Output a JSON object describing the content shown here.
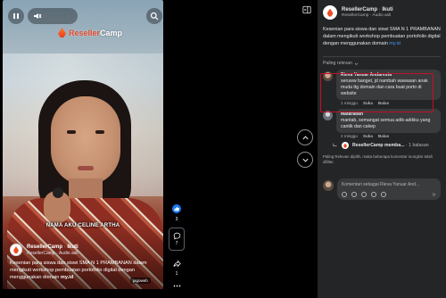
{
  "video": {
    "logo_brand": "Reseller",
    "logo_suffix": "Camp",
    "caption": "NAMA AKU CELINE ARTHA",
    "page_name": "ResellerCamp",
    "follow": "Ikuti",
    "audio": "ResellerCamp · Audio asli",
    "description": "Kesenian para siswa dan siswi SMA N 1 PRAMBANAN dalam mengikuti workshop pembuatan portofolio digital dengan menggunakan domain",
    "domain_link": "my.id",
    "watermark": "jagoweb"
  },
  "rail": {
    "like_count": "3",
    "comment_count": "7",
    "share_count": "1"
  },
  "panel": {
    "page_name": "ResellerCamp",
    "follow": "Ikuti",
    "audio": "ResellerCamp · Audio asli",
    "description": "Kesenian para siswa dan siswi SMA N 1 PRAMBANAN dalam mengikuti workshop pembuatan portofolio digital dengan menggunakan domain",
    "domain_link": "my.id",
    "sort_label": "Paling relevan"
  },
  "comments": [
    {
      "author": "Rieva Yanuar Andaresta",
      "text": "seruww banget, jd nambah wawasan anak muda ttg domain dan cara buat porto di website",
      "time": "1 minggu",
      "like": "Suka",
      "reply": "Balas"
    },
    {
      "author": "Mataraban",
      "text": "mantab, semangat semua adik-adikku yang cantik dan cakep",
      "time": "2 minggu",
      "like": "Suka",
      "reply": "Balas"
    }
  ],
  "reply_summary": {
    "name": "ResellerCamp memba...",
    "count": "· 1 balasan"
  },
  "notice": "Paling Relevan dipilih, maka beberapa komentar mungkin telah difilter.",
  "composer": {
    "placeholder": "Komentari sebagai Rieva Yanuar And..."
  },
  "colors": {
    "panel_bg": "#242526",
    "bubble_bg": "#3a3b3c",
    "link": "#4599ff",
    "highlight": "#c0112a",
    "brand": "#e94f22"
  }
}
